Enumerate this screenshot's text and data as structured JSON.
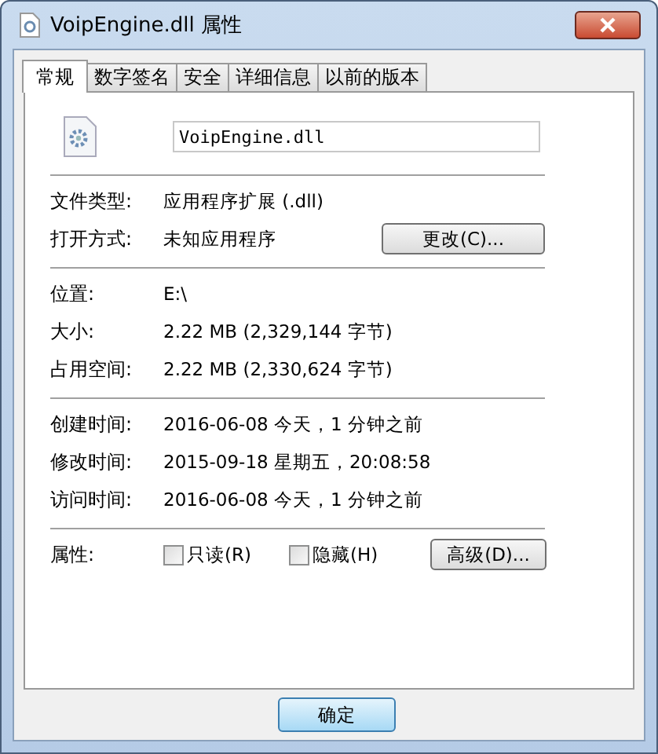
{
  "window": {
    "title": "VoipEngine.dll 属性"
  },
  "tabs": [
    {
      "label": "常规",
      "selected": true
    },
    {
      "label": "数字签名",
      "selected": false
    },
    {
      "label": "安全",
      "selected": false
    },
    {
      "label": "详细信息",
      "selected": false
    },
    {
      "label": "以前的版本",
      "selected": false
    }
  ],
  "file_name": {
    "value": "VoipEngine.dll"
  },
  "sections": [
    {
      "rows": [
        {
          "label": "文件类型:",
          "value": "应用程序扩展 (.dll)"
        },
        {
          "label": "打开方式:",
          "value": "未知应用程序",
          "button": "更改(C)..."
        }
      ]
    },
    {
      "rows": [
        {
          "label": "位置:",
          "value": "E:\\"
        },
        {
          "label": "大小:",
          "value": "2.22 MB (2,329,144 字节)"
        },
        {
          "label": "占用空间:",
          "value": "2.22 MB (2,330,624 字节)"
        }
      ]
    },
    {
      "rows": [
        {
          "label": "创建时间:",
          "value": "2016-06-08 今天，1 分钟之前"
        },
        {
          "label": "修改时间:",
          "value": "2015-09-18 星期五，20:08:58"
        },
        {
          "label": "访问时间:",
          "value": "2016-06-08 今天，1 分钟之前"
        }
      ]
    }
  ],
  "attributes": {
    "label": "属性:",
    "checkboxes": [
      {
        "label": "只读(R)",
        "checked": false
      },
      {
        "label": "隐藏(H)",
        "checked": false
      }
    ],
    "button": "高级(D)..."
  },
  "buttons": [
    {
      "label": "确定",
      "selected": true
    }
  ]
}
